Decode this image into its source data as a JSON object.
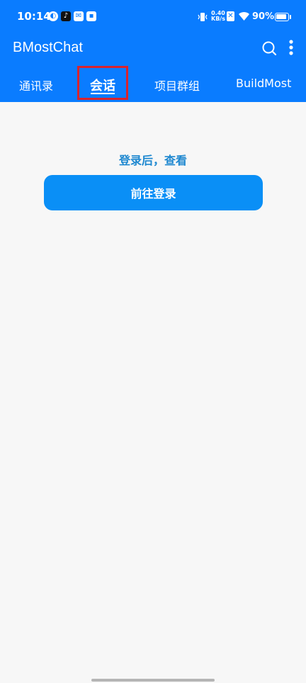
{
  "status_bar": {
    "time": "10:14",
    "net_speed_value": "0.40",
    "net_speed_unit": "KB/s",
    "battery": "90%",
    "battery_level": 0.9
  },
  "app_bar": {
    "title": "BMostChat",
    "search_icon": "search-icon",
    "more_icon": "more-vertical-icon"
  },
  "tabs": [
    {
      "label": "通讯录"
    },
    {
      "label": "会话",
      "selected": true
    },
    {
      "label": "项目群组"
    },
    {
      "label": "BuildMost"
    }
  ],
  "content": {
    "hint": "登录后，查看",
    "login_button": "前往登录"
  },
  "colors": {
    "primary": "#0a7cff",
    "button": "#0a8ff6",
    "hint_text": "#1e88d0",
    "highlight": "#d9232e"
  }
}
